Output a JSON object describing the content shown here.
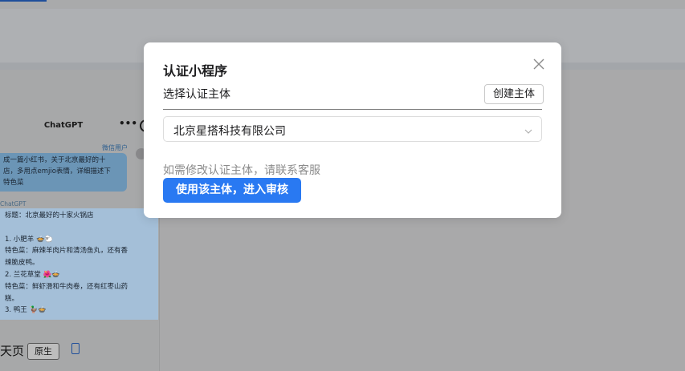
{
  "background": {
    "phone": {
      "title": "ChatGPT",
      "more": "•••",
      "user_tag": "微信用户",
      "user_message_lines": [
        "成一篇小红书，关于北京最好的十",
        "店，多用点emjio表情，详细描述下",
        "特色菜"
      ],
      "bot_tag": "ChatGPT",
      "bot_message_lines": [
        "标题：北京最好的十家火锅店",
        "",
        "1. 小肥羊 🍲🐑",
        "特色菜：麻辣羊肉片和清汤鱼丸，还有香",
        "辣脆皮鸭。",
        "2. 兰花草堂 🌺🍲",
        "特色菜：鲜虾滑和牛肉卷，还有红枣山药",
        "糕。",
        "3. 鸭王 🦆🍲"
      ]
    },
    "bottom": {
      "label": "天页",
      "button": "原生"
    }
  },
  "modal": {
    "title": "认证小程序",
    "section_label": "选择认证主体",
    "create_button": "创建主体",
    "select_value": "北京星搭科技有限公司",
    "hint": "如需修改认证主体，请联系客服",
    "primary_button": "使用该主体，进入审核"
  },
  "colors": {
    "primary": "#2979f2",
    "overlay": "#a9a9aa",
    "hint": "#8c8c8c"
  },
  "icons": {
    "close": "close-icon",
    "chevron": "chevron-down-icon",
    "device": "phone-icon"
  }
}
